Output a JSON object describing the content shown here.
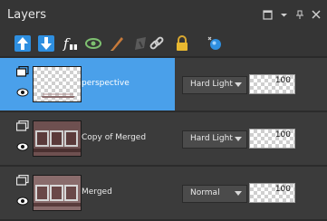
{
  "panel": {
    "title": "Layers"
  },
  "colors": {
    "selected_row": "#4aa0ea",
    "accent_blue": "#2e8fe0",
    "panel_bg": "#353535"
  },
  "toolbar": {
    "icons": [
      "move-up-icon",
      "move-down-icon",
      "new-layer-from-image-icon",
      "visibility-toggle-icon",
      "edit-mask-icon",
      "mask-disabled-icon",
      "link-icon",
      "lock-icon",
      "layer-effects-icon"
    ]
  },
  "layers": [
    {
      "name": "perspective",
      "blend_mode": "Hard Light",
      "opacity": "100",
      "selected": true
    },
    {
      "name": "Copy of Merged",
      "blend_mode": "Hard Light",
      "opacity": "100",
      "selected": false
    },
    {
      "name": "Merged",
      "blend_mode": "Normal",
      "opacity": "100",
      "selected": false
    }
  ]
}
